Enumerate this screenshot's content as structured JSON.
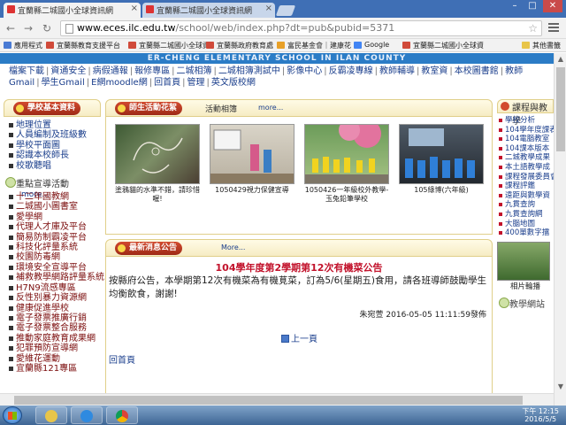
{
  "browser": {
    "tabs": [
      {
        "label": "宜蘭縣二城國小全球資訊網",
        "active": true
      },
      {
        "label": "宜蘭縣二城國小全球資訊網",
        "active": false
      }
    ],
    "url_host": "www.eces.ilc.edu.tw",
    "url_path": "/school/web/index.php?dt=pub&pubid=5371",
    "bookmarks": [
      "應用程式",
      "宜蘭縣教育支援平台",
      "宜蘭縣二城國小全球資",
      "宜蘭縣政府教育處",
      "富民基金會｜建康花",
      "Google",
      "宜蘭縣二城國小全球資"
    ],
    "bookmarks_other": "其他書籤"
  },
  "page": {
    "banner": "ER-CHENG ELEMENTARY SCHOOL IN ILAN COUNTY",
    "topnav": [
      "檔案下載",
      "資通安全",
      "病假通報",
      "報修專區",
      "二城相簿",
      "二城相簿測試中",
      "影像中心",
      "反霸凌專線",
      "教師輔導",
      "教室資",
      "本校圖書館",
      "教師Gmail",
      "學生Gmail",
      "E網moodle網",
      "回首頁",
      "管理",
      "英文版校網"
    ],
    "left": {
      "header": "學校基本資料",
      "items": [
        "地理位置",
        "人員編制及班級數",
        "學校平面圖",
        "認識本校師長",
        "校歌聽唱"
      ],
      "section2_title": "重點宣導活動",
      "section2_more": "more...",
      "items2": [
        "十二年國教網",
        "二城國小圖書室",
        "愛學網",
        "代理人才庫及平台",
        "簡易防制霸凌平台",
        "科技化評量系統",
        "校園防毒網",
        "環境安全宣導平台",
        "補救教學網路評量系統",
        "H7N9流感專區",
        "反性別暴力資源網",
        "健康促進學校",
        "電子發票推廣行銷",
        "電子發票整合服務",
        "推動家庭教育成果網",
        "犯罪預防宣導網",
        "愛維花運動",
        "宜蘭縣121專區"
      ]
    },
    "album": {
      "header": "師生活動花絮",
      "category": "活動相簿",
      "more": "more...",
      "photos": [
        {
          "caption": "塗鴉貓的水準不錯，請珍惜喔!"
        },
        {
          "caption": "1050429視力保健宣導"
        },
        {
          "caption": "1050426一年級校外教學-玉兔鉛筆學校"
        },
        {
          "caption": "105綠博(六年級)"
        }
      ]
    },
    "news": {
      "header": "最新消息公告",
      "more": "More...",
      "title": "104學年度第2學期第12次有機菜公告",
      "body": "按縣府公告，本學期第12次有機菜為有機莧菜，訂為5/6(星期五)食用，請各班導師鼓勵學生均衡飲食，謝謝!",
      "meta": "朱宛萱  2016-05-05 11:11:59發佈",
      "prev": "上一頁",
      "home": "回首頁"
    },
    "right": {
      "header": "課程與教學",
      "items": [
        "學校分析",
        "104學年度課表",
        "104電腦教室",
        "104課本版本",
        "二城教學成果",
        "本土語教學成",
        "課程發展委員會",
        "課程評鑑",
        "遠距與數學資",
        "九貫查詢",
        "九貫查詢網",
        "大腦地圖",
        "400單數字擂"
      ],
      "photo_caption": "相片輪播",
      "section2_title": "教學網站"
    }
  },
  "taskbar": {
    "time": "下午 12:15",
    "date": "2016/5/5"
  }
}
